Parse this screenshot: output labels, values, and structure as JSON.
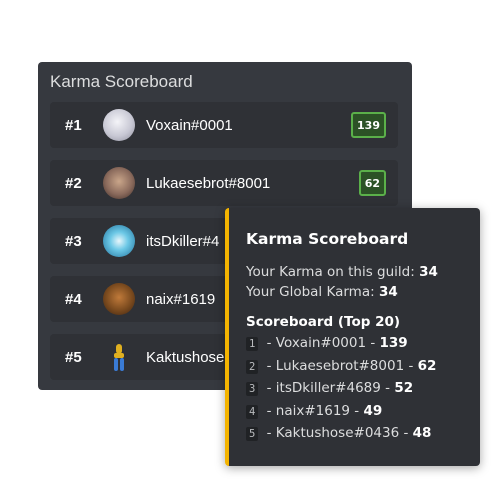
{
  "panel": {
    "title": "Karma Scoreboard",
    "rows": [
      {
        "rank": "#1",
        "name": "Voxain#0001",
        "karma": "139",
        "avatar_color": "#c8c8d4"
      },
      {
        "rank": "#2",
        "name": "Lukaesebrot#8001",
        "karma": "62",
        "avatar_color": "#8a6a5c"
      },
      {
        "rank": "#3",
        "name": "itsDkiller#4",
        "karma": "",
        "avatar_color": "#3aa7c9"
      },
      {
        "rank": "#4",
        "name": "naix#1619",
        "karma": "",
        "avatar_color": "#7a4a1e"
      },
      {
        "rank": "#5",
        "name": "Kaktushose",
        "karma": "",
        "avatar_color": "#e0b020"
      }
    ]
  },
  "embed": {
    "title": "Karma Scoreboard",
    "guild_label": "Your Karma on this guild: ",
    "guild_value": "34",
    "global_label": "Your Global Karma: ",
    "global_value": "34",
    "scoreboard_heading": "Scoreboard (Top 20)",
    "entries": [
      {
        "num": "1",
        "text": " - Voxain#0001 - ",
        "value": "139"
      },
      {
        "num": "2",
        "text": " - Lukaesebrot#8001 - ",
        "value": "62"
      },
      {
        "num": "3",
        "text": " - itsDkiller#4689 - ",
        "value": "52"
      },
      {
        "num": "4",
        "text": " - naix#1619 - ",
        "value": "49"
      },
      {
        "num": "5",
        "text": " - Kaktushose#0436 - ",
        "value": "48"
      }
    ]
  },
  "colors": {
    "accent": "#f4b400",
    "badge_border": "#5bb04a",
    "panel_bg": "#36393f",
    "row_bg": "#2f3136"
  }
}
